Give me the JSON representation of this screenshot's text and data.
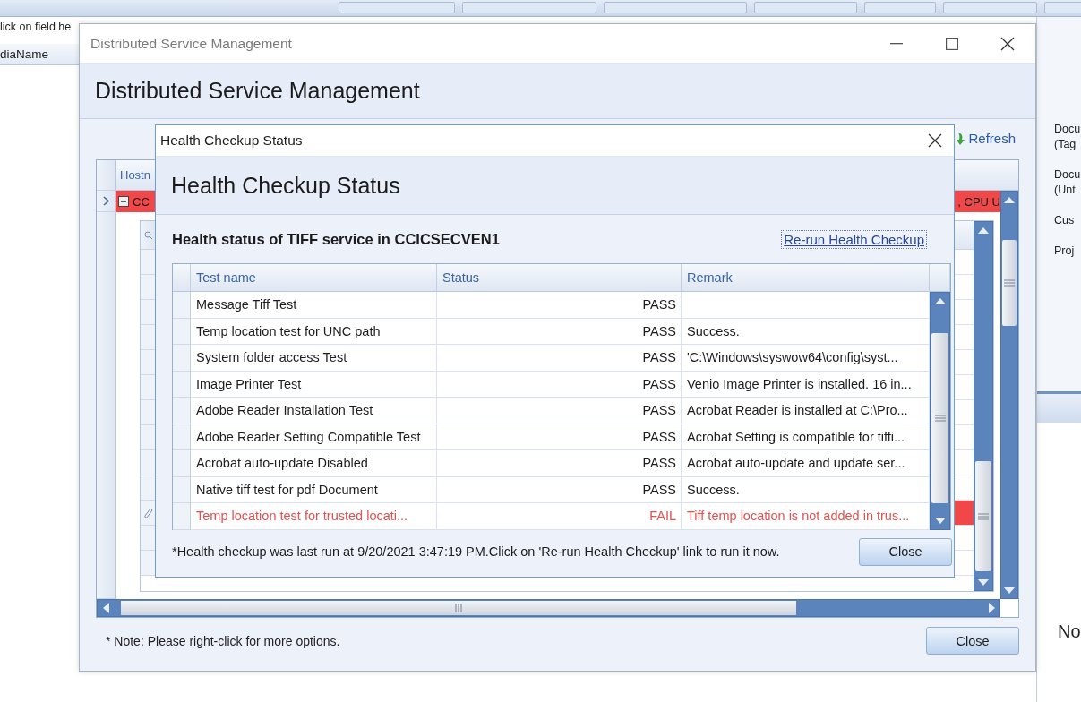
{
  "background": {
    "hint": "lick on field he",
    "column_header": "diaName",
    "side_groups": [
      [
        "Docu",
        "(Tag"
      ],
      [
        "Docu",
        "(Unt"
      ],
      [
        "Cus"
      ],
      [
        "Proj"
      ]
    ],
    "side_note": "No"
  },
  "main_window": {
    "title": "Distributed Service Management",
    "heading": "Distributed Service Management",
    "refresh": "Refresh",
    "grid": {
      "header": "Hostn",
      "row_left": "CC",
      "row_right": ", CPU U",
      "detail_rows": [
        {
          "failed": false
        },
        {
          "failed": false
        },
        {
          "failed": false
        },
        {
          "failed": false
        },
        {
          "failed": false
        },
        {
          "failed": false
        },
        {
          "failed": false
        },
        {
          "failed": false
        },
        {
          "failed": false
        },
        {
          "failed": false
        },
        {
          "failed": true
        },
        {
          "failed": false
        },
        {
          "failed": false
        }
      ]
    },
    "note": "* Note: Please right-click for more options.",
    "close": "Close"
  },
  "dialog": {
    "title": "Health Checkup Status",
    "heading": "Health Checkup Status",
    "subtitle": "Health status of TIFF service in CCICSECVEN1",
    "rerun_link": "Re-run Health Checkup",
    "columns": [
      "Test name",
      "Status",
      "Remark"
    ],
    "rows": [
      {
        "test": "Message Tiff Test",
        "status": "PASS",
        "remark": "",
        "failed": false
      },
      {
        "test": "Temp location test for UNC path",
        "status": "PASS",
        "remark": "Success.",
        "failed": false
      },
      {
        "test": "System folder access Test",
        "status": "PASS",
        "remark": "'C:\\Windows\\syswow64\\config\\syst...",
        "failed": false
      },
      {
        "test": "Image Printer Test",
        "status": "PASS",
        "remark": "Venio Image Printer is installed. 16 in...",
        "failed": false
      },
      {
        "test": "Adobe Reader Installation Test",
        "status": "PASS",
        "remark": "Acrobat Reader is installed at C:\\Pro...",
        "failed": false
      },
      {
        "test": "Adobe Reader Setting Compatible Test",
        "status": "PASS",
        "remark": "Acrobat Setting is compatible for tiffi...",
        "failed": false
      },
      {
        "test": "Acrobat auto-update Disabled",
        "status": "PASS",
        "remark": "Acrobat auto-update and update ser...",
        "failed": false
      },
      {
        "test": "Native tiff test for pdf Document",
        "status": "PASS",
        "remark": "Success.",
        "failed": false
      },
      {
        "test": "Temp location test for trusted locati...",
        "status": "FAIL",
        "remark": "Tiff temp location is not added in trus...",
        "failed": true
      }
    ],
    "footer": "*Health checkup was last run at 9/20/2021 3:47:19 PM.Click on 'Re-run Health Checkup' link to run it now.",
    "close": "Close"
  }
}
